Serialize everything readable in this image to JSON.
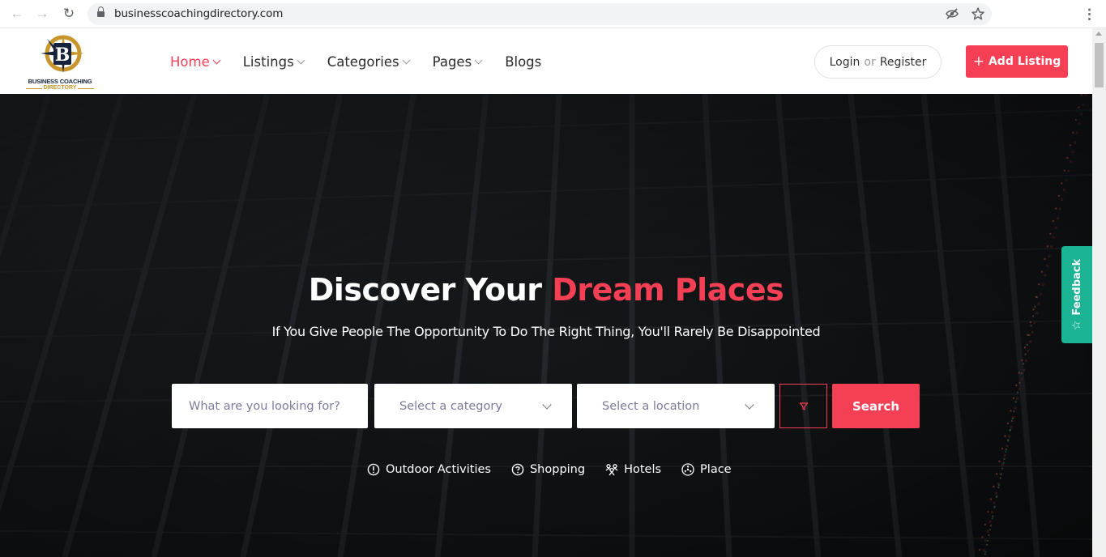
{
  "browser": {
    "url": "businesscoachingdirectory.com",
    "back_icon": "arrow-left-icon",
    "forward_icon": "arrow-right-icon",
    "reload_icon": "reload-icon",
    "lock_icon": "lock-icon",
    "hidden_icon": "eye-slash-icon",
    "bookmark_icon": "star-icon",
    "menu_icon": "kebab-menu-icon"
  },
  "logo": {
    "line1": "BUSINESS COACHING",
    "line2": "DIRECTORY",
    "colors": {
      "navy": "#17233a",
      "gold": "#c9962e"
    }
  },
  "nav": {
    "items": [
      {
        "label": "Home",
        "has_dropdown": true,
        "active": true
      },
      {
        "label": "Listings",
        "has_dropdown": true,
        "active": false
      },
      {
        "label": "Categories",
        "has_dropdown": true,
        "active": false
      },
      {
        "label": "Pages",
        "has_dropdown": true,
        "active": false
      },
      {
        "label": "Blogs",
        "has_dropdown": false,
        "active": false
      }
    ]
  },
  "auth": {
    "login": "Login",
    "or": "or",
    "register": "Register"
  },
  "add_listing": {
    "icon": "plus-icon",
    "label": "Add Listing"
  },
  "hero": {
    "title_plain": "Discover Your",
    "title_accent": "Dream Places",
    "subtitle": "If You Give People The Opportunity To Do The Right Thing, You'll Rarely Be Disappointed"
  },
  "search": {
    "keyword_placeholder": "What are you looking for?",
    "category_value": "Select a category",
    "location_value": "Select a location",
    "filter_icon": "filter-icon",
    "button_label": "Search"
  },
  "quick_categories": [
    {
      "label": "Outdoor Activities",
      "icon": "info-circle-icon"
    },
    {
      "label": "Shopping",
      "icon": "question-circle-icon"
    },
    {
      "label": "Hotels",
      "icon": "people-icon"
    },
    {
      "label": "Place",
      "icon": "radiation-icon"
    }
  ],
  "feedback": {
    "label": "Feedback",
    "icon": "star-outline-icon"
  },
  "colors": {
    "accent": "#f43f54",
    "feedback": "#1ab394",
    "hero_bg": "#15181b"
  }
}
